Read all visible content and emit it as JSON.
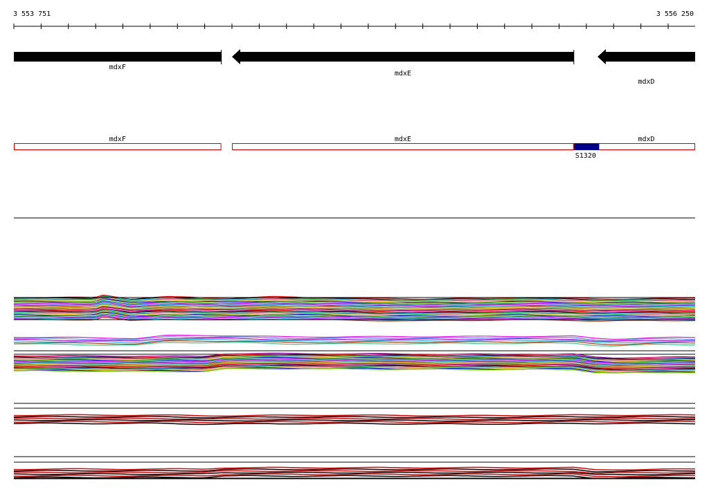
{
  "ruler": {
    "start_label": "3 553 751",
    "end_label": "3 556 250",
    "start": 3553751,
    "end": 3556250
  },
  "genes": [
    {
      "name": "mdxF",
      "start": 3553751,
      "end": 3554512,
      "strand": "-"
    },
    {
      "name": "mdxE",
      "start": 3554551,
      "end": 3555805,
      "strand": "-"
    },
    {
      "name": "mdxD",
      "start": 3555892,
      "end": 3556250,
      "strand": "-"
    }
  ],
  "features": [
    {
      "label": "S1320",
      "start": 3555805,
      "end": 3555898,
      "color": "#00008b"
    }
  ],
  "colors": {
    "gene_arrow": "#000000",
    "gene_box_outline": "#d00000",
    "feature_fill": "#00008b",
    "track_line_a": "#000000",
    "track_line_b": "#e00000"
  },
  "chart_data": {
    "type": "line",
    "title": "",
    "xlabel": "",
    "ylabel": "",
    "xlim": [
      3553751,
      3556250
    ],
    "groups": [
      {
        "lines": 34,
        "multicolor": true,
        "profile": [
          [
            3553751,
            0
          ],
          [
            3554050,
            0
          ],
          [
            3554080,
            -4
          ],
          [
            3554180,
            2
          ],
          [
            3554310,
            -1
          ],
          [
            3554550,
            1
          ],
          [
            3554700,
            -1
          ],
          [
            3555000,
            1
          ],
          [
            3555250,
            2
          ],
          [
            3555600,
            0
          ],
          [
            3555805,
            1
          ],
          [
            3555900,
            2
          ],
          [
            3556250,
            1
          ]
        ]
      },
      {
        "lines": 6,
        "multicolor": true,
        "profile": [
          [
            3553751,
            0
          ],
          [
            3554200,
            2
          ],
          [
            3554310,
            -2
          ],
          [
            3554550,
            -2
          ],
          [
            3554750,
            0
          ],
          [
            3555805,
            -1
          ],
          [
            3555880,
            2
          ],
          [
            3555950,
            3
          ],
          [
            3556100,
            1
          ],
          [
            3556250,
            1
          ]
        ]
      },
      {
        "lines": 30,
        "multicolor": true,
        "profile": [
          [
            3553751,
            0
          ],
          [
            3554450,
            1
          ],
          [
            3554520,
            -3
          ],
          [
            3554800,
            -3
          ],
          [
            3555400,
            -2
          ],
          [
            3555805,
            -2
          ],
          [
            3555880,
            2
          ],
          [
            3555950,
            3
          ],
          [
            3556250,
            2
          ]
        ]
      },
      {
        "lines": 6,
        "multicolor": false,
        "profile": [
          [
            3553751,
            0
          ],
          [
            3554300,
            0
          ],
          [
            3554450,
            1
          ],
          [
            3554900,
            0
          ],
          [
            3555400,
            1
          ],
          [
            3555805,
            0
          ],
          [
            3556250,
            0
          ]
        ]
      },
      {
        "lines": 6,
        "multicolor": false,
        "profile": [
          [
            3553751,
            0
          ],
          [
            3554450,
            0
          ],
          [
            3554520,
            -2
          ],
          [
            3555805,
            -2
          ],
          [
            3555880,
            1
          ],
          [
            3556250,
            0
          ]
        ]
      }
    ]
  }
}
